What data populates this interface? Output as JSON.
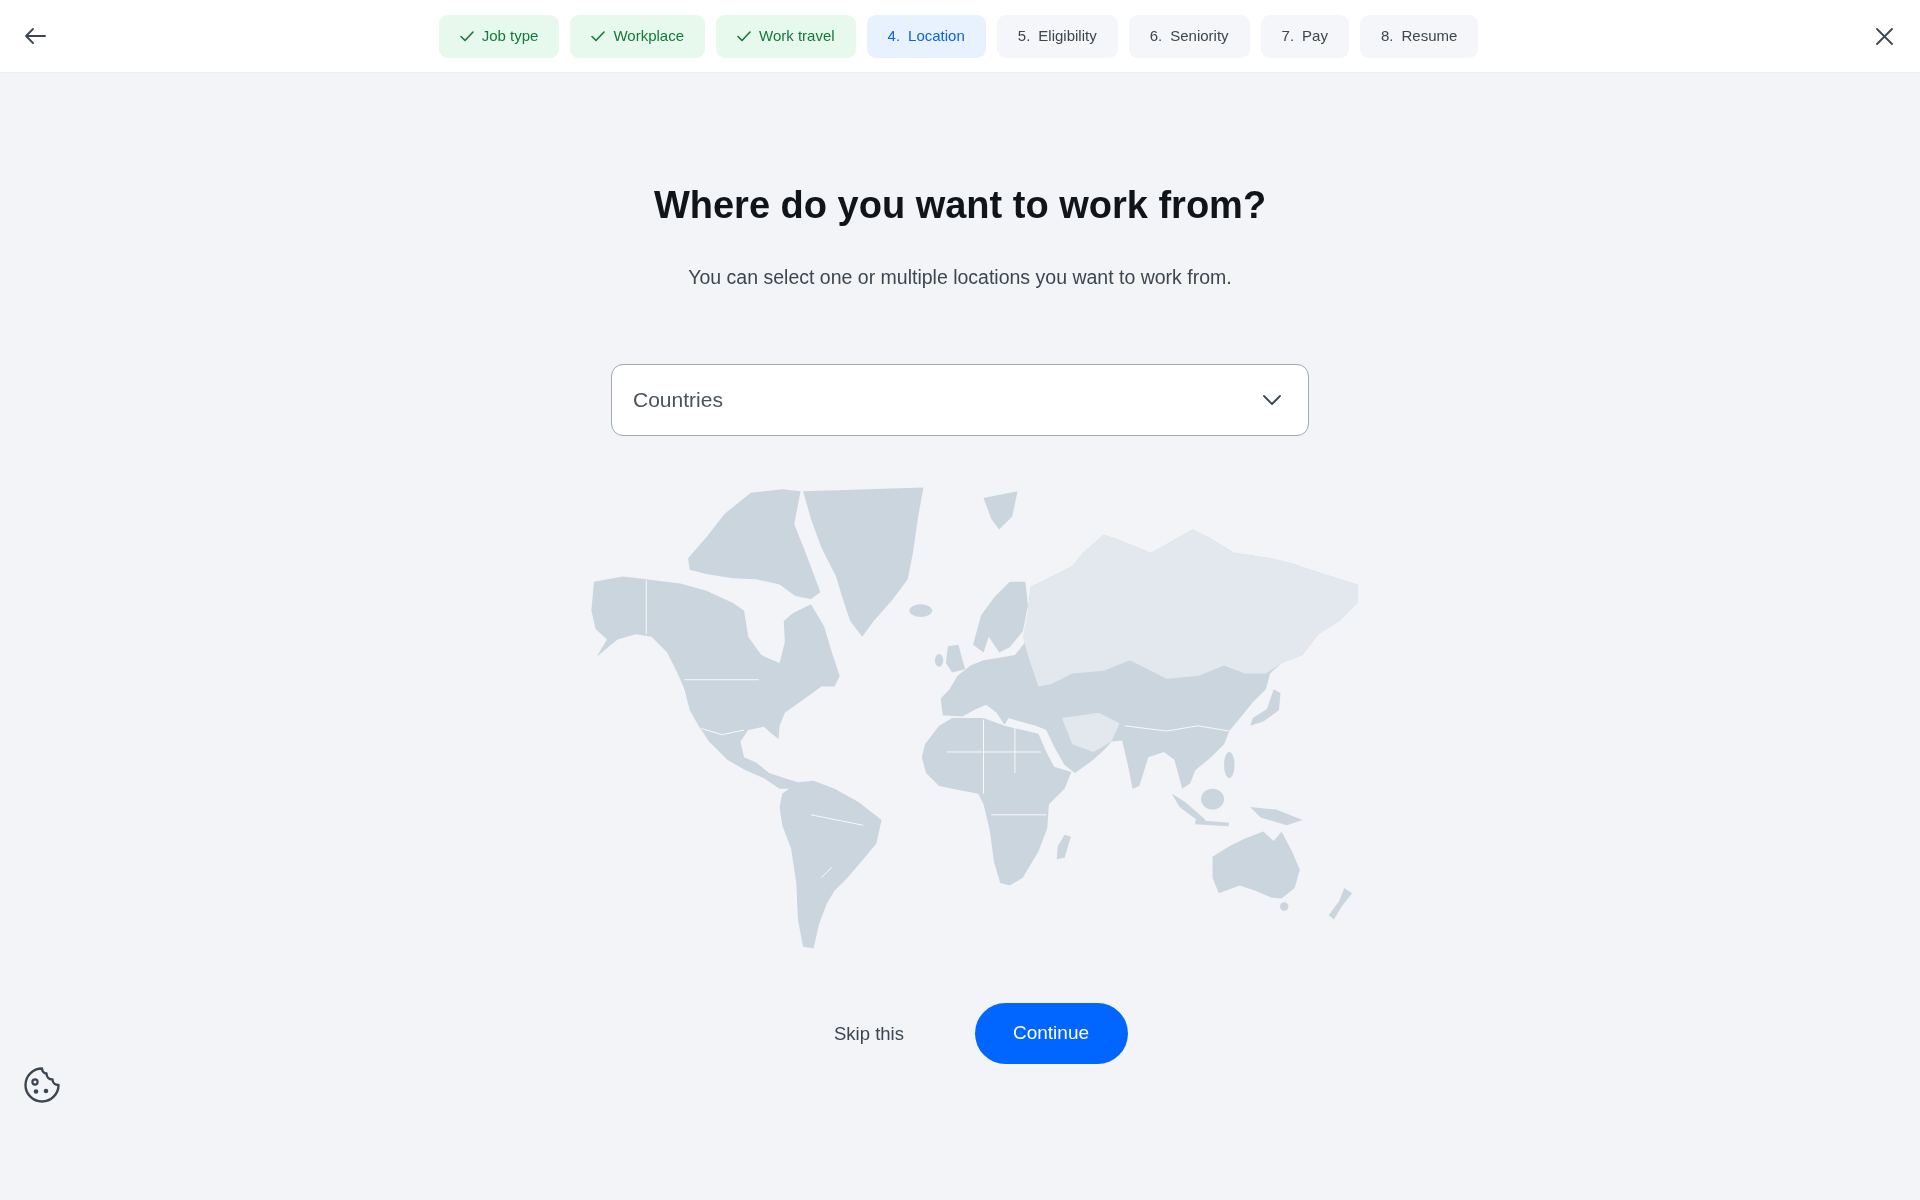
{
  "header": {
    "steps": [
      {
        "label": "Job type",
        "completed": true,
        "selected": false
      },
      {
        "label": "Workplace",
        "completed": true,
        "selected": false
      },
      {
        "label": "Work travel",
        "completed": true,
        "selected": false
      },
      {
        "number": "4.",
        "label": "Location",
        "completed": false,
        "selected": true
      },
      {
        "number": "5.",
        "label": "Eligibility",
        "completed": false,
        "selected": false
      },
      {
        "number": "6.",
        "label": "Seniority",
        "completed": false,
        "selected": false
      },
      {
        "number": "7.",
        "label": "Pay",
        "completed": false,
        "selected": false
      },
      {
        "number": "8.",
        "label": "Resume",
        "completed": false,
        "selected": false
      }
    ]
  },
  "question": {
    "title": "Where do you want to work from?",
    "subtitle": "You can select one or multiple locations you want to work from."
  },
  "countries_select": {
    "placeholder": "Countries"
  },
  "actions": {
    "skip": "Skip this",
    "continue": "Continue"
  }
}
